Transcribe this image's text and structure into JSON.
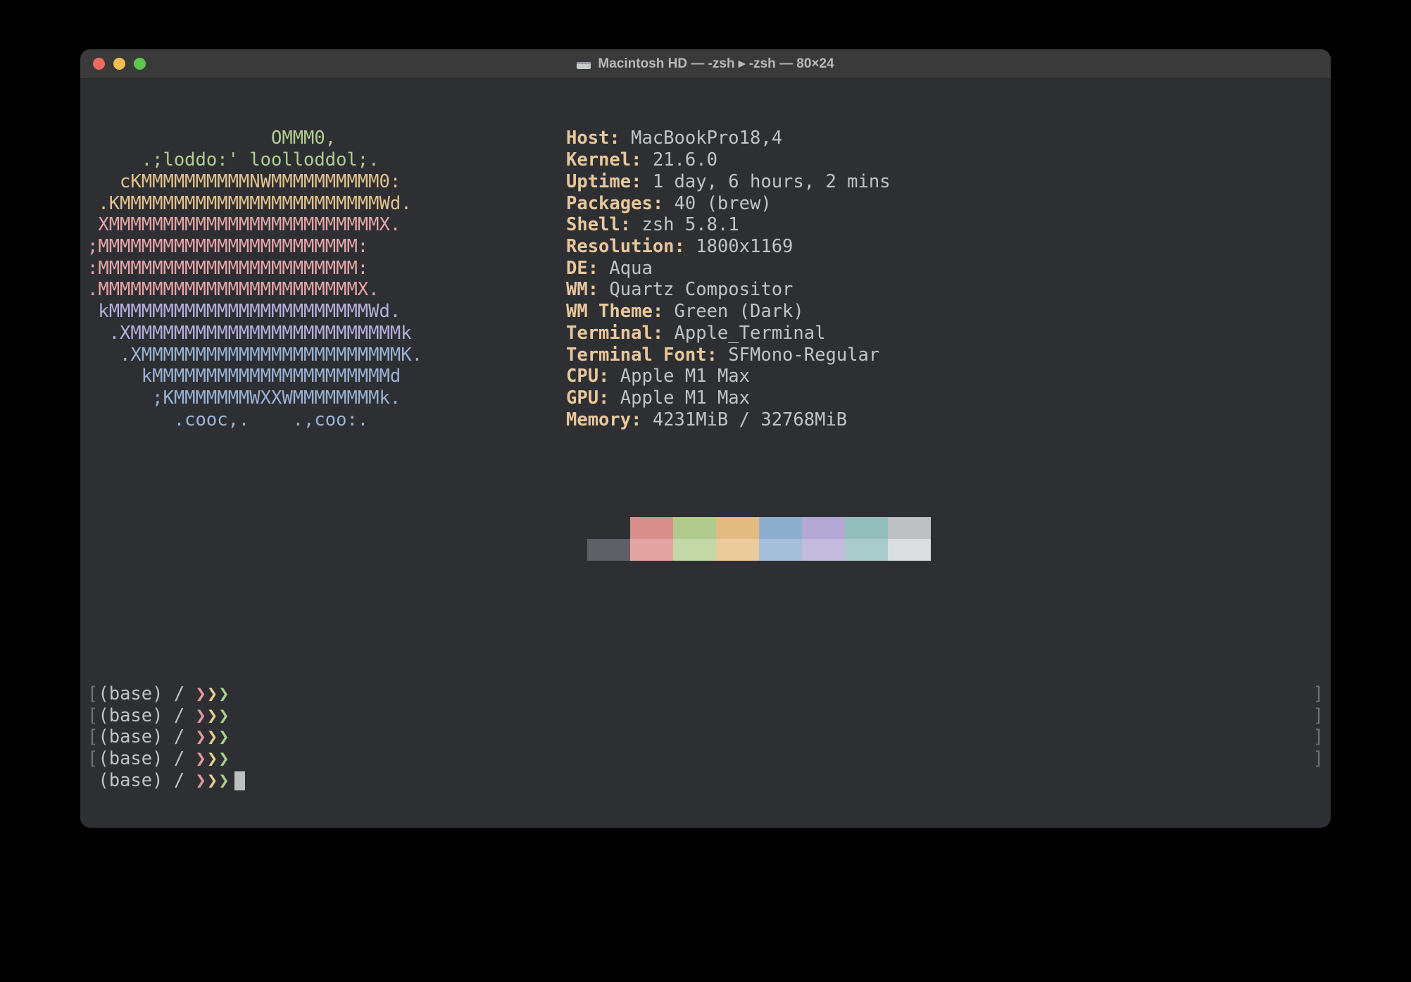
{
  "titlebar": {
    "title": "Macintosh HD — -zsh ▸ -zsh — 80×24"
  },
  "ascii_art": [
    {
      "text": "                 OMMM0,              ",
      "color": "c-green"
    },
    {
      "text": "     .;loddo:' loolloddol;.          ",
      "color": "c-green"
    },
    {
      "text": "   cKMMMMMMMMMMNWMMMMMMMMMM0:        ",
      "color": "c-yellow"
    },
    {
      "text": " .KMMMMMMMMMMMMMMMMMMMMMMMMWd.       ",
      "color": "c-yellow"
    },
    {
      "text": " XMMMMMMMMMMMMMMMMMMMMMMMMMX.        ",
      "color": "c-pink"
    },
    {
      "text": ";MMMMMMMMMMMMMMMMMMMMMMMM:           ",
      "color": "c-pink"
    },
    {
      "text": ":MMMMMMMMMMMMMMMMMMMMMMMM:           ",
      "color": "c-pink"
    },
    {
      "text": ".MMMMMMMMMMMMMMMMMMMMMMMMX.          ",
      "color": "c-pink"
    },
    {
      "text": " kMMMMMMMMMMMMMMMMMMMMMMMMWd.        ",
      "color": "c-purple"
    },
    {
      "text": "  .XMMMMMMMMMMMMMMMMMMMMMMMMMk       ",
      "color": "c-purple"
    },
    {
      "text": "   .XMMMMMMMMMMMMMMMMMMMMMMMMK.      ",
      "color": "c-blue"
    },
    {
      "text": "     kMMMMMMMMMMMMMMMMMMMMMMd        ",
      "color": "c-blue"
    },
    {
      "text": "      ;KMMMMMMMWXXWMMMMMMMMk.        ",
      "color": "c-blue"
    },
    {
      "text": "        .cooc,.    .,coo:.           ",
      "color": "c-blue"
    }
  ],
  "info": [
    {
      "label": "Host",
      "value": "MacBookPro18,4"
    },
    {
      "label": "Kernel",
      "value": "21.6.0"
    },
    {
      "label": "Uptime",
      "value": "1 day, 6 hours, 2 mins"
    },
    {
      "label": "Packages",
      "value": "40 (brew)"
    },
    {
      "label": "Shell",
      "value": "zsh 5.8.1"
    },
    {
      "label": "Resolution",
      "value": "1800x1169"
    },
    {
      "label": "DE",
      "value": "Aqua"
    },
    {
      "label": "WM",
      "value": "Quartz Compositor"
    },
    {
      "label": "WM Theme",
      "value": "Green (Dark)"
    },
    {
      "label": "Terminal",
      "value": "Apple_Terminal"
    },
    {
      "label": "Terminal Font",
      "value": "SFMono-Regular"
    },
    {
      "label": "CPU",
      "value": "Apple M1 Max"
    },
    {
      "label": "GPU",
      "value": "Apple M1 Max"
    },
    {
      "label": "Memory",
      "value": "4231MiB / 32768MiB"
    }
  ],
  "palette": {
    "row1": [
      "#2e2f32",
      "#d98e8e",
      "#b1ca8e",
      "#e2bb82",
      "#8eaed0",
      "#b3a7d4",
      "#93bdbb",
      "#bfc0c2"
    ],
    "row2": [
      "#5f6065",
      "#e4a4a4",
      "#c3d7a7",
      "#ebcb9c",
      "#a6bfdb",
      "#c5bbde",
      "#aacccb",
      "#dcddde"
    ]
  },
  "prompts": {
    "base": "(base)",
    "pwd": "/",
    "arrows": "❯❯❯",
    "history_count": 4
  }
}
